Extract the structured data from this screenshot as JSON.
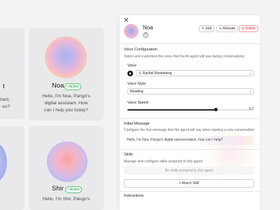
{
  "cards": [
    {
      "id": "left-top",
      "name": "t",
      "partial": true
    },
    {
      "id": "noa",
      "name": "Noa",
      "badge": "• Active",
      "desc_lines": [
        "Hello, I'm Noa, Pango's",
        "digital assistant. How",
        "can I help you today?"
      ]
    },
    {
      "id": "left-mid",
      "desc_lines": [
        "rsonal assistant,",
        "ou?"
      ]
    },
    {
      "id": "shir",
      "name": "Shir",
      "badge": "• Active",
      "desc_lines": [
        "Hello, I'm Shir, Pango's"
      ]
    }
  ],
  "left_texts": {
    "t": "t",
    "line1": "rsonal assistant,",
    "line2": "ou?"
  },
  "panel": {
    "close": "✕",
    "title": "Noa",
    "phone_icon": "✆",
    "actions": {
      "edit": "✎ Edit",
      "activate": "⊳ Activate",
      "delete": "⊖ Delete"
    },
    "voice_config": {
      "title": "Voice Configuration",
      "desc": "Select and customize the voice that the AI agent will use during conversations",
      "voice_label": "Voice",
      "voice_value": "Rachel Rosenberg",
      "style_label": "Voice Style",
      "style_value": "Reading",
      "speed_label": "Voice Speed",
      "speed_value": "0.7",
      "speed_fraction": 0.7
    },
    "initial_message": {
      "title": "Initial Message",
      "desc": "Configure the first message that the agent will say when starting a new conversation",
      "value": "Hello, I'm Noa, Pango's digital representative, how can I help?"
    },
    "skills": {
      "title": "Skills",
      "desc": "Manage and configure skills assigned to this agent.",
      "empty": "No skills assigned to this agent",
      "attach": "+ Attach Skill"
    },
    "instructions_title": "Instructions"
  }
}
